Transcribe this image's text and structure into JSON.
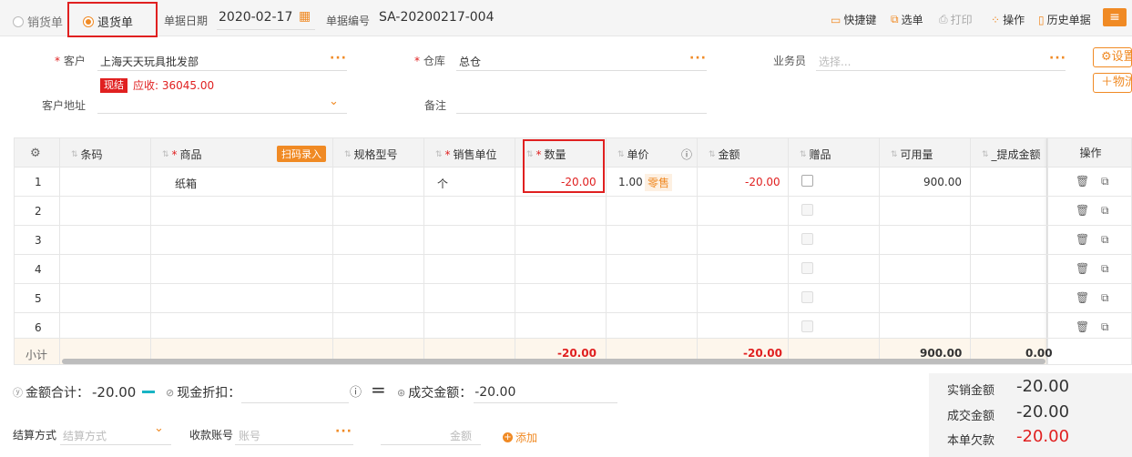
{
  "topbar": {
    "sales_radio": "销货单",
    "return_radio": "退货单",
    "date_label": "单据日期",
    "date_value": "2020-02-17",
    "number_label": "单据编号",
    "number_value": "SA-20200217-004",
    "shortcut": "快捷键",
    "select_order": "选单",
    "print": "打印",
    "operation": "操作",
    "history": "历史单据"
  },
  "form": {
    "customer_label": "客户",
    "customer_value": "上海天天玩具批发部",
    "warehouse_label": "仓库",
    "warehouse_value": "总仓",
    "salesman_label": "业务员",
    "salesman_placeholder": "选择...",
    "settle_tag": "现结",
    "receivable": "应收: 36045.00",
    "address_label": "客户地址",
    "remark_label": "备注",
    "settings_btn": "设置",
    "logistics_btn": "物流"
  },
  "grid": {
    "headers": {
      "barcode": "条码",
      "product": "商品",
      "scan": "扫码录入",
      "spec": "规格型号",
      "unit": "销售单位",
      "qty": "数量",
      "price": "单价",
      "amount": "金额",
      "gift": "赠品",
      "available": "可用量",
      "commission": "_提成金额",
      "ops": "操作"
    },
    "row_numbers": [
      "1",
      "2",
      "3",
      "4",
      "5",
      "6"
    ],
    "row1": {
      "product": "纸箱",
      "unit": "个",
      "qty": "-20.00",
      "price": "1.00",
      "price_tag": "零售",
      "amount": "-20.00",
      "available": "900.00"
    },
    "subtotal": {
      "label": "小计",
      "qty": "-20.00",
      "amount": "-20.00",
      "available": "900.00",
      "commission": "0.00"
    }
  },
  "bottom": {
    "total_label": "金额合计：",
    "total_value": "-20.00",
    "discount_label": "现金折扣：",
    "deal_label": "成交金额：",
    "deal_value": "-20.00",
    "settle_label": "结算方式",
    "settle_placeholder": "结算方式",
    "account_label": "收款账号",
    "account_placeholder": "账号",
    "amount_placeholder": "金额",
    "add": "添加"
  },
  "summary": {
    "actual_label": "实销金额",
    "actual_value": "-20.00",
    "deal_label": "成交金额",
    "deal_value": "-20.00",
    "owed_label": "本单欠款",
    "owed_value": "-20.00"
  }
}
